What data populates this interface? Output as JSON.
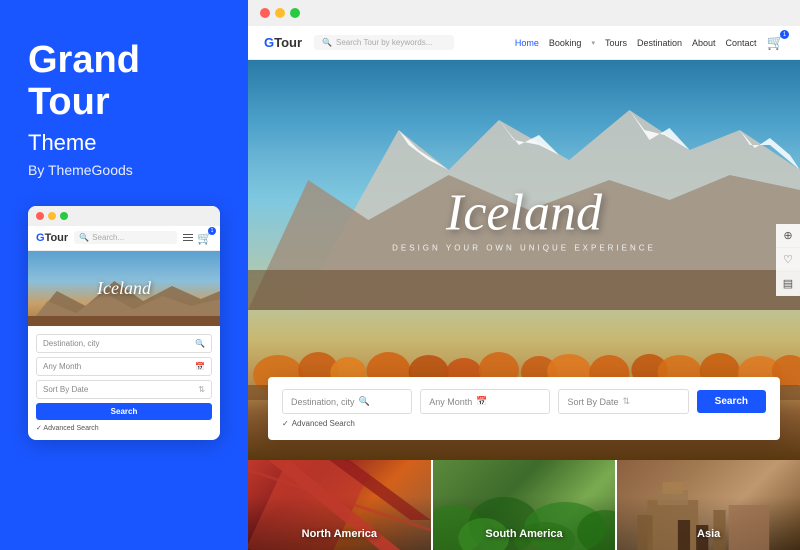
{
  "left": {
    "title1": "Grand",
    "title2": "Tour",
    "subtitle": "Theme",
    "by": "By ThemeGoods",
    "mini": {
      "logo_g": "G",
      "logo_tour": "Tour",
      "search_placeholder": "Search...",
      "hero_text": "Iceland",
      "field1": "Destination, city",
      "field2": "Any Month",
      "field3": "Sort By Date",
      "search_btn": "Search",
      "advanced": "✓ Advanced Search"
    }
  },
  "right": {
    "browser_dots": [
      "dot-red",
      "dot-yellow",
      "dot-green"
    ],
    "site": {
      "logo_g": "G",
      "logo_tour": "Tour",
      "search_placeholder": "Search Tour by keywords...",
      "nav_links": [
        "Home",
        "Booking",
        "Tours",
        "Destination",
        "About",
        "Contact"
      ],
      "hero_title": "Iceland",
      "hero_subtitle": "DESIGN YOUR OWN UNIQUE EXPERIENCE",
      "sidebar_icons": [
        "⊕",
        "♡",
        "▤"
      ],
      "form": {
        "field1": "Destination, city",
        "field2": "Any Month",
        "field3": "Sort By Date",
        "search_btn": "Search",
        "advanced": "Advanced Search"
      },
      "destinations": [
        {
          "label": "North America"
        },
        {
          "label": "South America"
        },
        {
          "label": "Asia"
        }
      ]
    }
  },
  "colors": {
    "brand_blue": "#1a56ff",
    "white": "#ffffff",
    "dark": "#333333"
  }
}
